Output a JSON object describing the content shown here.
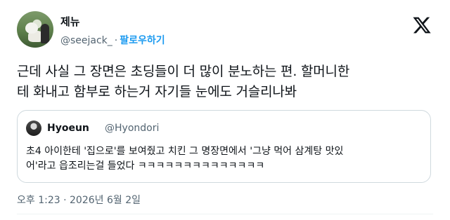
{
  "author": {
    "display_name": "제뉴",
    "handle": "@seejack_",
    "separator": "·",
    "follow_label": "팔로우하기"
  },
  "platform_logo": "x-logo-icon",
  "tweet": {
    "line1": "근데 사실 그 장면은 초딩들이 더 많이 분노하는 편.  할머니한",
    "line2": "테 화내고 함부로 하는거 자기들 눈에도 거슬리나봐"
  },
  "quoted_tweet": {
    "display_name": "Hyoeun",
    "handle": "@Hyondori",
    "line1": "초4 아이한테 '집으로'를 보여줬고 치킨 그 명장면에서 '그냥 먹어 삼계탕 맛있",
    "line2": "어'라고 읍조리는걸 들었다 ㅋㅋㅋㅋㅋㅋㅋㅋㅋㅋㅋㅋㅋㅋ"
  },
  "timestamp": {
    "time": "오후 1:23",
    "separator": "·",
    "date": "2026년 6월 2일"
  },
  "colors": {
    "text": "#0f1419",
    "secondary": "#536471",
    "accent": "#1d9bf0",
    "border": "#cfd9de"
  }
}
